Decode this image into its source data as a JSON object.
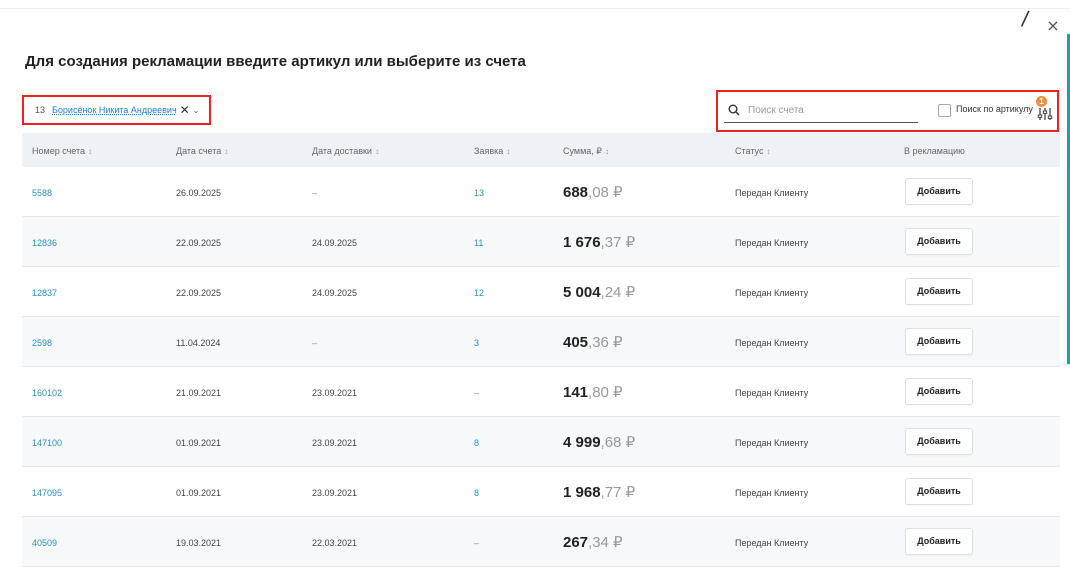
{
  "modal": {
    "title": "Для создания рекламации введите артикул или выберите из счета",
    "slash": "/",
    "close": "×"
  },
  "filter": {
    "number": "13",
    "name": "Борисёнок Никита Андреевич",
    "clear": "✕",
    "chevron": "⌄"
  },
  "search": {
    "placeholder": "Поиск счета",
    "value": "",
    "article_label": "Поиск по артикулу",
    "article_checked": false,
    "settings_badge": "1"
  },
  "table": {
    "columns": [
      "Номер счета",
      "Дата счета",
      "Дата доставки",
      "Заявка",
      "Сумма, ₽",
      "Статус",
      "В рекламацию"
    ],
    "sort_glyph": "↕",
    "add_label": "Добавить",
    "rows": [
      {
        "number": "5588",
        "date": "26.09.2025",
        "delivery": "–",
        "order": "13",
        "sum_main": "688",
        "sum_cents": ",08 ₽",
        "status": "Передан Клиенту"
      },
      {
        "number": "12836",
        "date": "22.09.2025",
        "delivery": "24.09.2025",
        "order": "11",
        "sum_main": "1 676",
        "sum_cents": ",37 ₽",
        "status": "Передан Клиенту"
      },
      {
        "number": "12837",
        "date": "22.09.2025",
        "delivery": "24.09.2025",
        "order": "12",
        "sum_main": "5 004",
        "sum_cents": ",24 ₽",
        "status": "Передан Клиенту"
      },
      {
        "number": "2598",
        "date": "11.04.2024",
        "delivery": "–",
        "order": "3",
        "sum_main": "405",
        "sum_cents": ",36 ₽",
        "status": "Передан Клиенту"
      },
      {
        "number": "160102",
        "date": "21.09.2021",
        "delivery": "23.09.2021",
        "order": "–",
        "sum_main": "141",
        "sum_cents": ",80 ₽",
        "status": "Передан Клиенту"
      },
      {
        "number": "147100",
        "date": "01.09.2021",
        "delivery": "23.09.2021",
        "order": "8",
        "sum_main": "4 999",
        "sum_cents": ",68 ₽",
        "status": "Передан Клиенту"
      },
      {
        "number": "147095",
        "date": "01.09.2021",
        "delivery": "23.09.2021",
        "order": "8",
        "sum_main": "1 968",
        "sum_cents": ",77 ₽",
        "status": "Передан Клиенту"
      },
      {
        "number": "40509",
        "date": "19.03.2021",
        "delivery": "22.03.2021",
        "order": "–",
        "sum_main": "267",
        "sum_cents": ",34 ₽",
        "status": "Передан Клиенту"
      }
    ]
  },
  "colors": {
    "link": "#2a8fb8",
    "highlight_border": "#ee2222",
    "accent": "#1aa0a4",
    "badge": "#f0903a"
  },
  "icons": {
    "search": "search-icon",
    "settings": "filter-settings-icon",
    "close": "close-icon"
  }
}
